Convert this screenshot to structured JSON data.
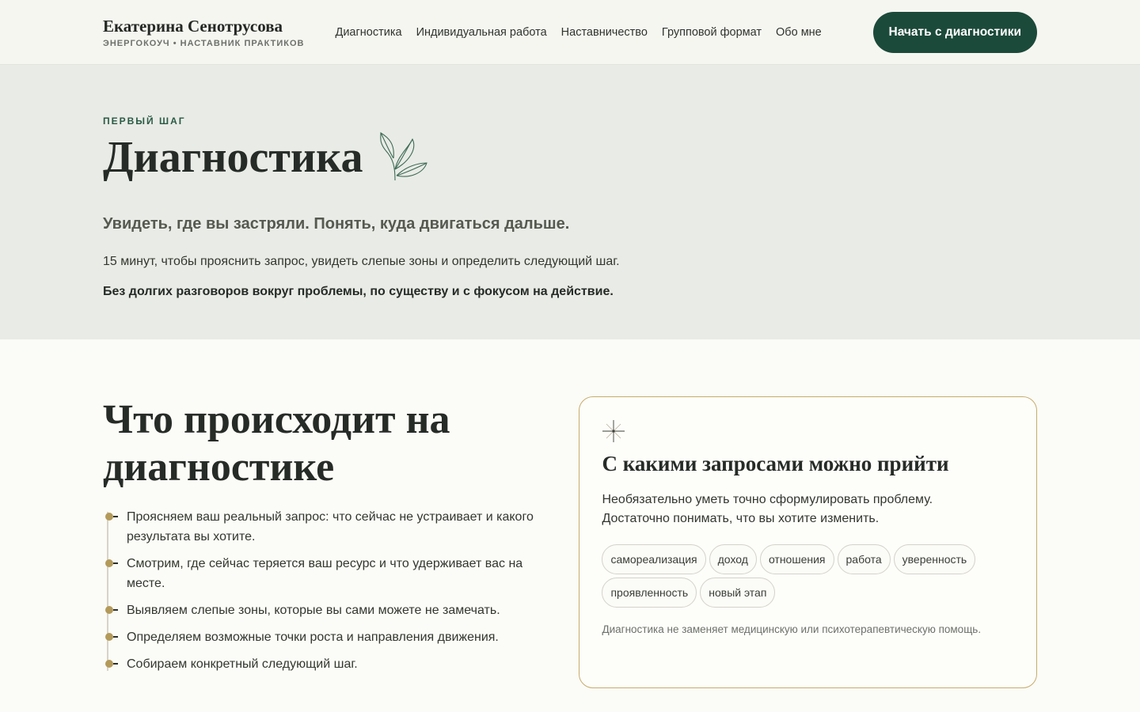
{
  "header": {
    "brand_name": "Екатерина Сенотрусова",
    "brand_subtitle": "ЭНЕРГОКОУЧ • НАСТАВНИК ПРАКТИКОВ",
    "nav": [
      {
        "label": "Диагностика"
      },
      {
        "label": "Индивидуальная работа"
      },
      {
        "label": "Наставничество"
      },
      {
        "label": "Групповой формат"
      },
      {
        "label": "Обо мне"
      }
    ],
    "cta_label": "Начать с диагностики"
  },
  "hero": {
    "eyebrow": "ПЕРВЫЙ ШАГ",
    "title": "Диагностика",
    "icon": "leaf-icon",
    "lead": "Увидеть, где вы застряли. Понять, куда двигаться дальше.",
    "text": "15 минут, чтобы прояснить запрос, увидеть слепые зоны и определить следующий шаг.",
    "bold_text": "Без долгих разговоров вокруг проблемы, по существу и с фокусом на действие."
  },
  "process": {
    "title": "Что происходит на диагностике",
    "steps": [
      "Проясняем ваш реальный запрос: что сейчас не устраивает и какого результата вы хотите.",
      "Смотрим, где сейчас теряется ваш ресурс и что удерживает вас на месте.",
      "Выявляем слепые зоны, которые вы сами можете не замечать.",
      "Определяем возможные точки роста и направления движения.",
      "Собираем конкретный следующий шаг."
    ]
  },
  "requests_card": {
    "icon": "sparkle-icon",
    "title": "С какими запросами можно прийти",
    "text": "Необязательно уметь точно сформулировать проблему. Достаточно понимать, что вы хотите изменить.",
    "tags": [
      "самореализация",
      "доход",
      "отношения",
      "работа",
      "уверенность",
      "проявленность",
      "новый этап"
    ],
    "note": "Диагностика не заменяет медицинскую или психотерапевтическую помощь."
  },
  "colors": {
    "accent_green": "#1c4a3a",
    "gold": "#b39a5a",
    "hero_bg": "#e9ebe6"
  }
}
